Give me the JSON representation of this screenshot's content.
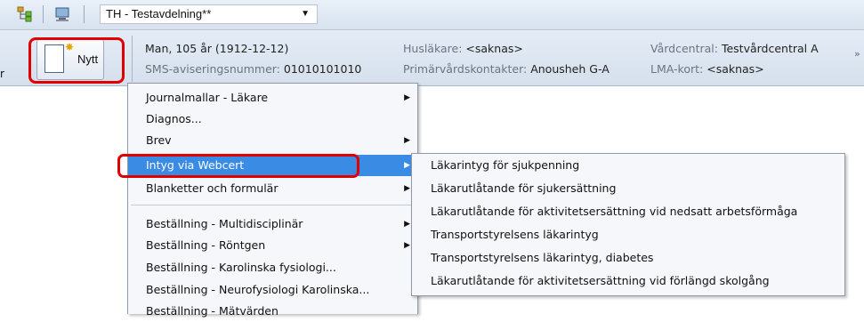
{
  "toolbar": {
    "unit_select_value": "TH - Testavdelning**"
  },
  "patient_bar": {
    "left_fragment": "r",
    "nytt_label": "Nytt",
    "patient": "Man, 105 år (1912-12-12)",
    "sms_label": "SMS-aviseringsnummer:",
    "sms_value": "01010101010",
    "huslakare_label": "Husläkare:",
    "huslakare_value": "<saknas>",
    "primary_label": "Primärvårdskontakter:",
    "primary_value": "Anousheh G-A",
    "vardcentral_label": "Vårdcentral:",
    "vardcentral_value": "Testvårdcentral A",
    "lma_label": "LMA-kort:",
    "lma_value": "<saknas>"
  },
  "menu": {
    "items": [
      {
        "label": "Journalmallar - Läkare",
        "submenu": true
      },
      {
        "label": "Diagnos...",
        "submenu": false
      },
      {
        "label": "Brev",
        "submenu": true
      },
      {
        "label": "Intyg via Webcert",
        "submenu": true,
        "highlighted": true
      },
      {
        "label": "Blanketter och formulär",
        "submenu": true
      },
      {
        "label": "Beställning - Multidisciplinär",
        "submenu": true
      },
      {
        "label": "Beställning - Röntgen",
        "submenu": true
      },
      {
        "label": "Beställning - Karolinska fysiologi...",
        "submenu": false
      },
      {
        "label": "Beställning - Neurofysiologi Karolinska...",
        "submenu": false
      },
      {
        "label": "Beställning - Mätvärden",
        "submenu": false
      }
    ]
  },
  "submenu": {
    "items": [
      {
        "label": "Läkarintyg för sjukpenning"
      },
      {
        "label": "Läkarutlåtande för sjukersättning"
      },
      {
        "label": "Läkarutlåtande för aktivitetsersättning vid nedsatt arbetsförmåga"
      },
      {
        "label": "Transportstyrelsens läkarintyg"
      },
      {
        "label": "Transportstyrelsens läkarintyg, diabetes"
      },
      {
        "label": "Läkarutlåtande för aktivitetsersättning vid förlängd skolgång"
      }
    ]
  },
  "colors": {
    "highlight": "#3a8be3",
    "annotation_red": "#e00000"
  }
}
